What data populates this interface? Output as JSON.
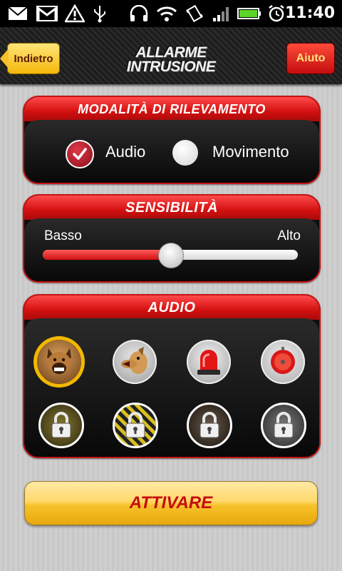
{
  "status_bar": {
    "time": "11:40",
    "icons": [
      "mail-icon",
      "gmail-icon",
      "warning-icon",
      "usb-icon",
      "headphones-icon",
      "wifi-icon",
      "vibrate-icon",
      "signal-icon",
      "battery-icon",
      "alarm-clock-icon"
    ]
  },
  "header": {
    "back_label": "Indietro",
    "title_line1": "ALLARME",
    "title_line2": "INTRUSIONE",
    "help_label": "Aiuto"
  },
  "detection": {
    "title": "MODALITÀ DI RILEVAMENTO",
    "options": [
      {
        "label": "Audio",
        "selected": true
      },
      {
        "label": "Movimento",
        "selected": false
      }
    ]
  },
  "sensitivity": {
    "title": "SENSIBILITÀ",
    "low_label": "Basso",
    "high_label": "Alto",
    "value_fraction": 0.5
  },
  "audio": {
    "title": "AUDIO",
    "sounds": [
      {
        "icon": "angry-dog-icon",
        "selected": true,
        "locked": false
      },
      {
        "icon": "barking-dog-icon",
        "selected": false,
        "locked": false
      },
      {
        "icon": "siren-light-icon",
        "selected": false,
        "locked": false
      },
      {
        "icon": "alarm-bell-icon",
        "selected": false,
        "locked": false
      },
      {
        "icon": "locked-sound-1-icon",
        "selected": false,
        "locked": true
      },
      {
        "icon": "locked-sound-2-icon",
        "selected": false,
        "locked": true
      },
      {
        "icon": "locked-sound-3-icon",
        "selected": false,
        "locked": true
      },
      {
        "icon": "locked-sound-4-icon",
        "selected": false,
        "locked": true
      }
    ]
  },
  "activate_label": "ATTIVARE",
  "colors": {
    "accent_red": "#d31010",
    "gold": "#f2b800",
    "panel_black": "#0e0e0e"
  }
}
